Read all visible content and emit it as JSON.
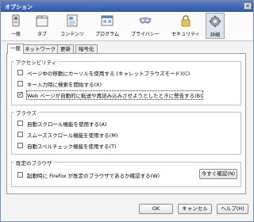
{
  "window": {
    "title": "オプション",
    "close_glyph": "✕"
  },
  "toolbar": {
    "items": [
      {
        "label": "一般",
        "icon": "general-switch-icon"
      },
      {
        "label": "タブ",
        "icon": "tabs-icon"
      },
      {
        "label": "コンテンツ",
        "icon": "content-page-icon"
      },
      {
        "label": "プログラム",
        "icon": "programs-window-icon"
      },
      {
        "label": "プライバシー",
        "icon": "privacy-mask-icon"
      },
      {
        "label": "セキュリティ",
        "icon": "security-padlock-icon"
      },
      {
        "label": "詳細",
        "icon": "advanced-gear-icon",
        "selected": true
      }
    ]
  },
  "tabs": [
    {
      "label": "一般",
      "active": true
    },
    {
      "label": "ネットワーク"
    },
    {
      "label": "更新"
    },
    {
      "label": "暗号化"
    }
  ],
  "accessibility": {
    "title": "アクセシビリティ",
    "options": [
      {
        "label": "ページ中の移動にカーソルを使用する (キャレットブラウズモード)(C)",
        "checked": false
      },
      {
        "label": "キー入力時に検索を開始する(X)",
        "checked": false
      },
      {
        "label": "Web ページが自動的に転送や再読み込みさせようとしたときに警告する(B)",
        "checked": true
      }
    ]
  },
  "browse": {
    "title": "ブラウズ",
    "options": [
      {
        "label": "自動スクロール機能を使用する(A)",
        "checked": false
      },
      {
        "label": "スムーズスクロール機能を使用する(M)",
        "checked": false
      },
      {
        "label": "自動スペルチェック機能を使用する(T)",
        "checked": false
      }
    ]
  },
  "default_browser": {
    "title": "既定のブラウザ",
    "option": {
      "label": "起動時に Firefox が既定のブラウザであるか確認する(W)",
      "checked": false
    },
    "check_now": "今すぐ確認(N)"
  },
  "footer": {
    "ok": "OK",
    "cancel": "キャンセル",
    "help": "ヘルプ(H)"
  },
  "colors": {
    "title_bar": "#2f56a6",
    "selected_tab": "#dde3ea"
  }
}
